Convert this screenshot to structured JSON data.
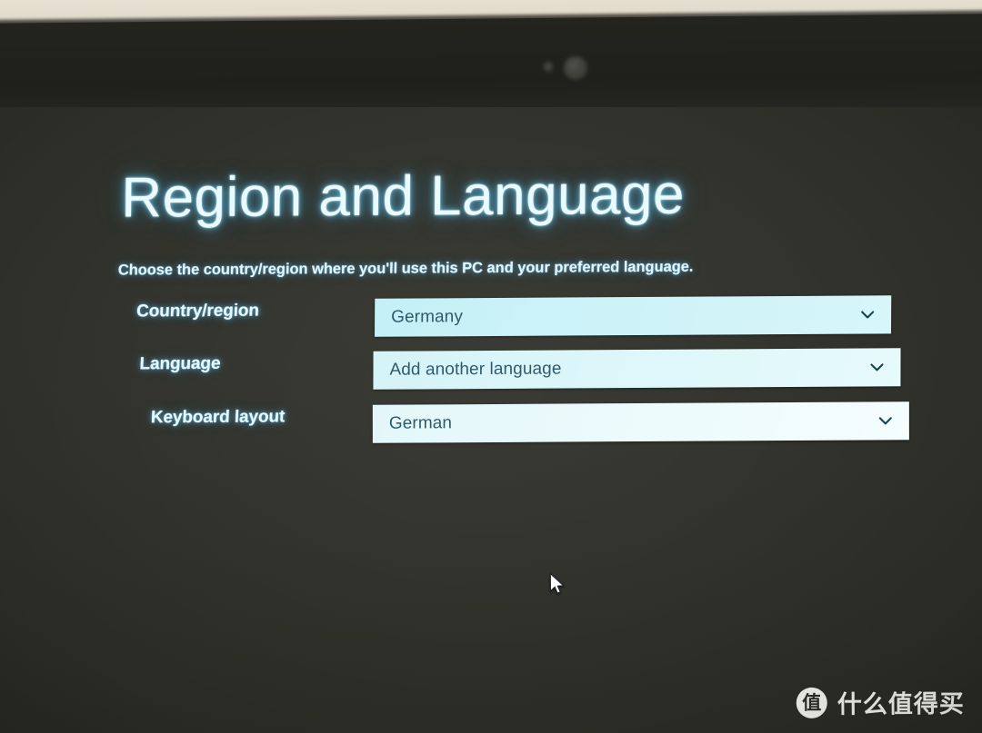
{
  "scene": {
    "description": "photo-of-laptop-screen",
    "desk_color": "#e8e1d3",
    "bezel_color": "#21211c",
    "screen_bg_color": "#30312a"
  },
  "device": {
    "webcam_label": "webcam-lens",
    "webcam_led_label": "webcam-indicator-led"
  },
  "page": {
    "title": "Region and Language",
    "subtitle": "Choose the country/region where you'll use this PC and your preferred language.",
    "title_color": "#e9fbff",
    "accent_glow_color": "#6ecdf5"
  },
  "form": {
    "rows": [
      {
        "label": "Country/region",
        "value": "Germany",
        "chevron_icon": "chevron-down-icon",
        "field_bg": "#c8f1f7",
        "text_color": "#2a5566"
      },
      {
        "label": "Language",
        "value": "Add another language",
        "chevron_icon": "chevron-down-icon",
        "field_bg": "#ddf7fa",
        "text_color": "#2a5566"
      },
      {
        "label": "Keyboard layout",
        "value": "German",
        "chevron_icon": "chevron-down-icon",
        "field_bg": "#eefbfc",
        "text_color": "#2a5566"
      }
    ]
  },
  "cursor": {
    "icon": "mouse-pointer-icon",
    "color": "#ffffff"
  },
  "watermark": {
    "logo_glyph": "值",
    "text": "什么值得买",
    "logo_bg": "#f2f2ef",
    "text_color": "#f2f3ef"
  }
}
